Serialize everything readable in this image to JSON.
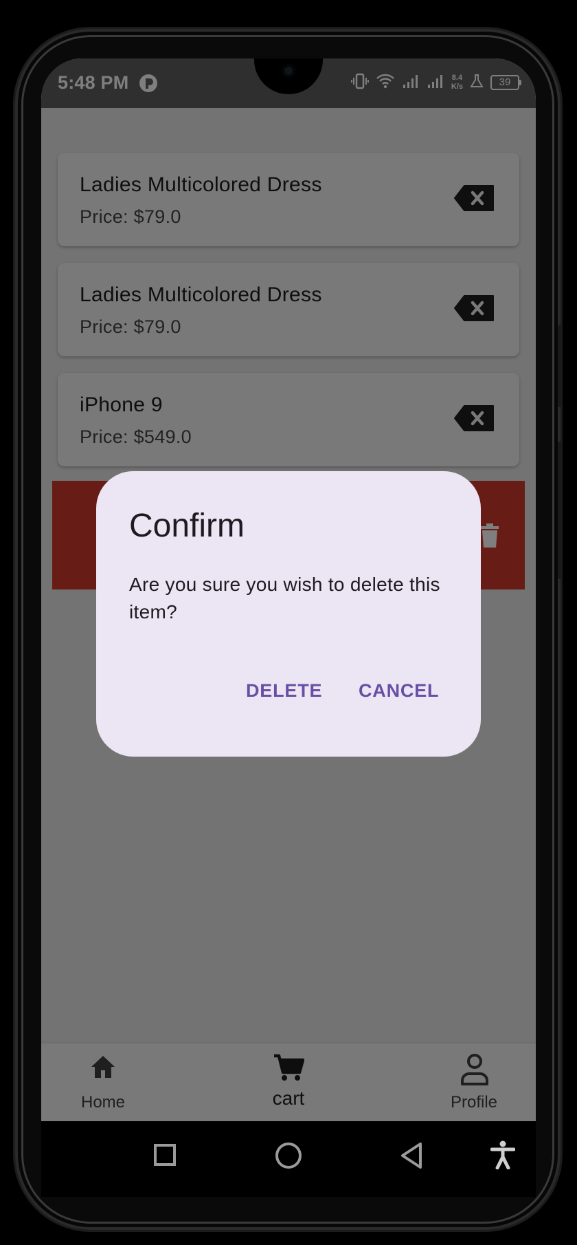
{
  "status_bar": {
    "time": "5:48 PM",
    "net_speed_value": "8.4",
    "net_speed_unit": "K/s",
    "battery": "39"
  },
  "cart": {
    "items": [
      {
        "name": "Ladies Multicolored Dress",
        "price": "Price: $79.0"
      },
      {
        "name": "Ladies Multicolored Dress",
        "price": "Price: $79.0"
      },
      {
        "name": "iPhone 9",
        "price": "Price: $549.0"
      }
    ]
  },
  "dialog": {
    "title": "Confirm",
    "message": "Are you sure you wish to delete this item?",
    "delete_label": "DELETE",
    "cancel_label": "CANCEL"
  },
  "bottom_nav": {
    "home_label": "Home",
    "cart_label": "cart",
    "profile_label": "Profile"
  },
  "colors": {
    "accent": "#6750a4",
    "dismiss_background": "#cf3b2b",
    "dialog_background": "#ece5f4"
  }
}
